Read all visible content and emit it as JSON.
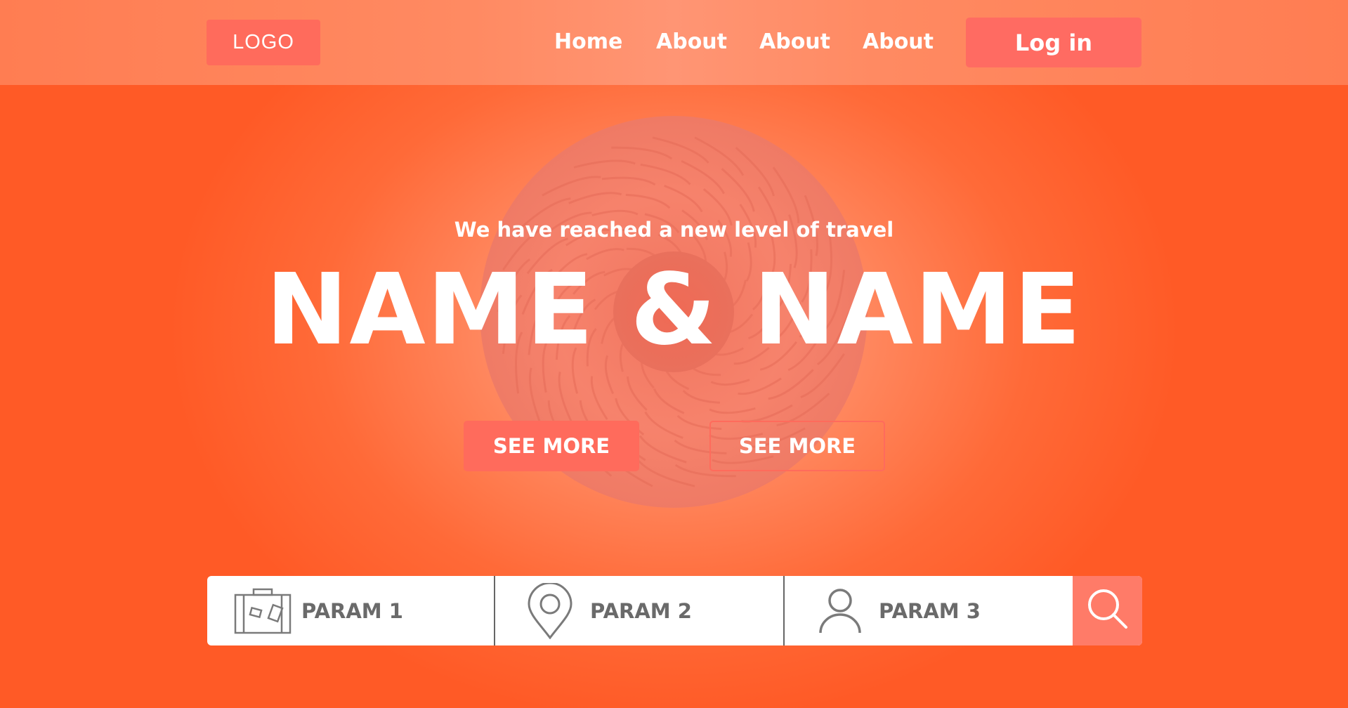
{
  "header": {
    "logo": "LOGO",
    "nav": [
      "Home",
      "About",
      "About",
      "About"
    ],
    "login_label": "Log in"
  },
  "hero": {
    "tagline": "We have reached a new level of travel",
    "title": "NAME & NAME",
    "primary_button": "SEE MORE",
    "secondary_button": "SEE MORE"
  },
  "search": {
    "params": [
      {
        "label": "PARAM 1",
        "icon": "suitcase-icon"
      },
      {
        "label": "PARAM 2",
        "icon": "location-pin-icon"
      },
      {
        "label": "PARAM 3",
        "icon": "user-icon"
      }
    ],
    "button_icon": "search-icon"
  },
  "colors": {
    "background": "#ff5a26",
    "accent": "#ff6b5c",
    "text": "#ffffff",
    "search_text": "#6a6a6a"
  }
}
